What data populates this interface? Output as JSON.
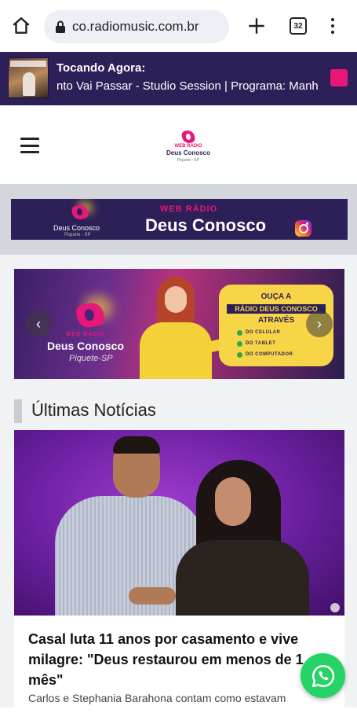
{
  "browser": {
    "url": "co.radiomusic.com.br",
    "tab_count": "32"
  },
  "player": {
    "label": "Tocando Agora:",
    "track": "nto Vai Passar - Studio Session | Programa: Manh"
  },
  "header_logo": {
    "small": "WEB RÁDIO",
    "name": "Deus Conosco",
    "city": "Piquete - SP"
  },
  "banner": {
    "logo_small": "Deus Conosco",
    "logo_city": "Piquete - SP",
    "web_label": "WEB RÁDIO",
    "title": "Deus Conosco"
  },
  "slider": {
    "web_label": "WEB RÁDIO",
    "name": "Deus Conosco",
    "city": "Piquete-SP",
    "panel_line1": "OUÇA A",
    "panel_line2": "RÁDIO DEUS CONOSCO",
    "panel_line3": "ATRAVÉS",
    "options": [
      "DO CELULAR",
      "DO TABLET",
      "DO COMPUTADOR"
    ],
    "prev_icon": "‹",
    "next_icon": "›"
  },
  "news": {
    "section_title": "Últimas Notícias",
    "title": "Casal luta 11 anos por casamento e vive milagre: \"Deus restaurou em menos de 1 mês\"",
    "excerpt": "Carlos e Stephania Barahona contam como estavam"
  },
  "colors": {
    "brand_dark": "#2d1f57",
    "brand_pink": "#e8177a",
    "whatsapp": "#25d366"
  },
  "icons": [
    "home-icon",
    "lock-icon",
    "plus-icon",
    "tabs-icon",
    "more-icon",
    "stop-icon",
    "menu-icon",
    "instagram-icon",
    "whatsapp-icon"
  ]
}
